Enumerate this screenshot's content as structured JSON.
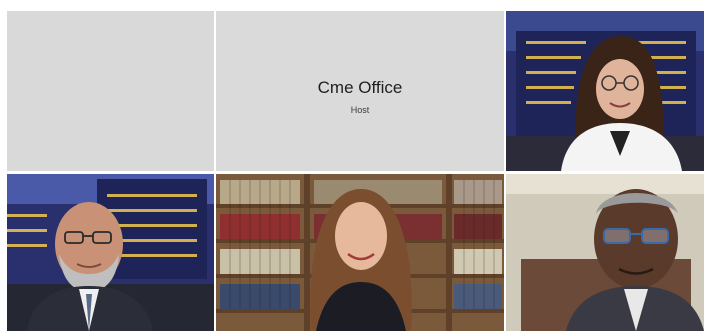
{
  "meeting": {
    "layout": "gallery-3x2",
    "participants": [
      {
        "id": "p1",
        "type": "no-video"
      },
      {
        "id": "p2",
        "type": "name-card",
        "name": "Cme Office",
        "role": "Host"
      },
      {
        "id": "p3",
        "type": "video",
        "background": "night-building"
      },
      {
        "id": "p4",
        "type": "video",
        "background": "night-building"
      },
      {
        "id": "p5",
        "type": "video",
        "background": "bookshelf"
      },
      {
        "id": "p6",
        "type": "video",
        "background": "office-wall"
      }
    ]
  },
  "colors": {
    "tile_gray": "#d9d9d9",
    "night_sky": "#2a2f6e",
    "building_glow": "#f2c94c",
    "bookshelf_wood": "#7a5a3a"
  }
}
